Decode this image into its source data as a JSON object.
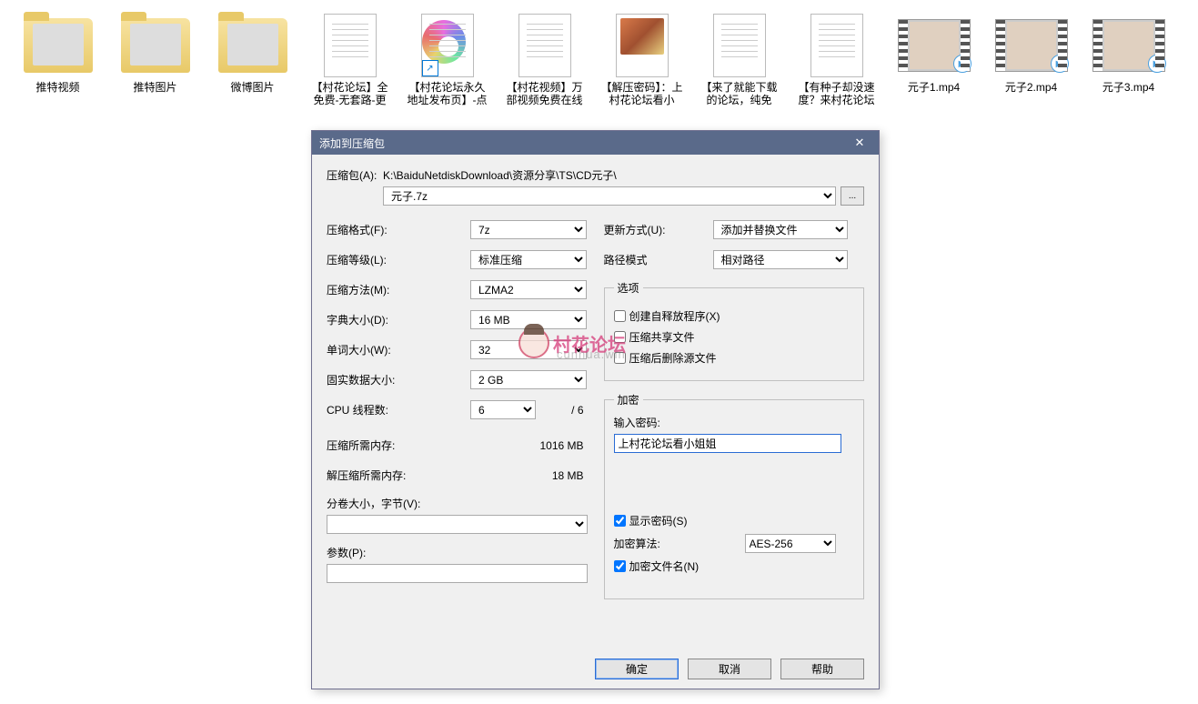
{
  "desktop_items": [
    {
      "type": "folder",
      "label": "推特视频"
    },
    {
      "type": "folder",
      "label": "推特图片"
    },
    {
      "type": "folder",
      "label": "微博图片"
    },
    {
      "type": "text",
      "label": "【村花论坛】全免费-无套路-更"
    },
    {
      "type": "url",
      "label": "【村花论坛永久地址发布页】-点"
    },
    {
      "type": "text",
      "label": "【村花视频】万部视频免费在线"
    },
    {
      "type": "paint",
      "label": "【解压密码】：上村花论坛看小"
    },
    {
      "type": "text",
      "label": "【来了就能下载的论坛，纯免"
    },
    {
      "type": "text",
      "label": "【有种子却没速度？来村花论坛"
    },
    {
      "type": "video",
      "label": "元子1.mp4"
    },
    {
      "type": "video",
      "label": "元子2.mp4"
    },
    {
      "type": "video",
      "label": "元子3.mp4"
    }
  ],
  "dialog": {
    "title": "添加到压缩包",
    "close": "✕",
    "archive_label": "压缩包(A):",
    "archive_path": "K:\\BaiduNetdiskDownload\\资源分享\\TS\\CD元子\\",
    "archive_name": "元子.7z",
    "browse": "...",
    "left": {
      "format_label": "压缩格式(F):",
      "format_value": "7z",
      "level_label": "压缩等级(L):",
      "level_value": "标准压缩",
      "method_label": "压缩方法(M):",
      "method_value": "LZMA2",
      "dict_label": "字典大小(D):",
      "dict_value": "16 MB",
      "word_label": "单词大小(W):",
      "word_value": "32",
      "solid_label": "固实数据大小:",
      "solid_value": "2 GB",
      "cpu_label": "CPU 线程数:",
      "cpu_value": "6",
      "cpu_max": "/ 6",
      "mem_comp_label": "压缩所需内存:",
      "mem_comp_value": "1016 MB",
      "mem_decomp_label": "解压缩所需内存:",
      "mem_decomp_value": "18 MB",
      "split_label": "分卷大小，字节(V):",
      "params_label": "参数(P):"
    },
    "right": {
      "update_label": "更新方式(U):",
      "update_value": "添加并替换文件",
      "path_label": "路径模式",
      "path_value": "相对路径",
      "options_legend": "选项",
      "opt_sfx": "创建自释放程序(X)",
      "opt_shared": "压缩共享文件",
      "opt_delete": "压缩后删除源文件",
      "enc_legend": "加密",
      "enc_pwd_label": "输入密码:",
      "enc_pwd_value": "上村花论坛看小姐姐",
      "enc_show": "显示密码(S)",
      "enc_algo_label": "加密算法:",
      "enc_algo_value": "AES-256",
      "enc_names": "加密文件名(N)"
    },
    "buttons": {
      "ok": "确定",
      "cancel": "取消",
      "help": "帮助"
    }
  },
  "watermark": {
    "text": "村花论坛",
    "sub": "cunhua.win"
  }
}
